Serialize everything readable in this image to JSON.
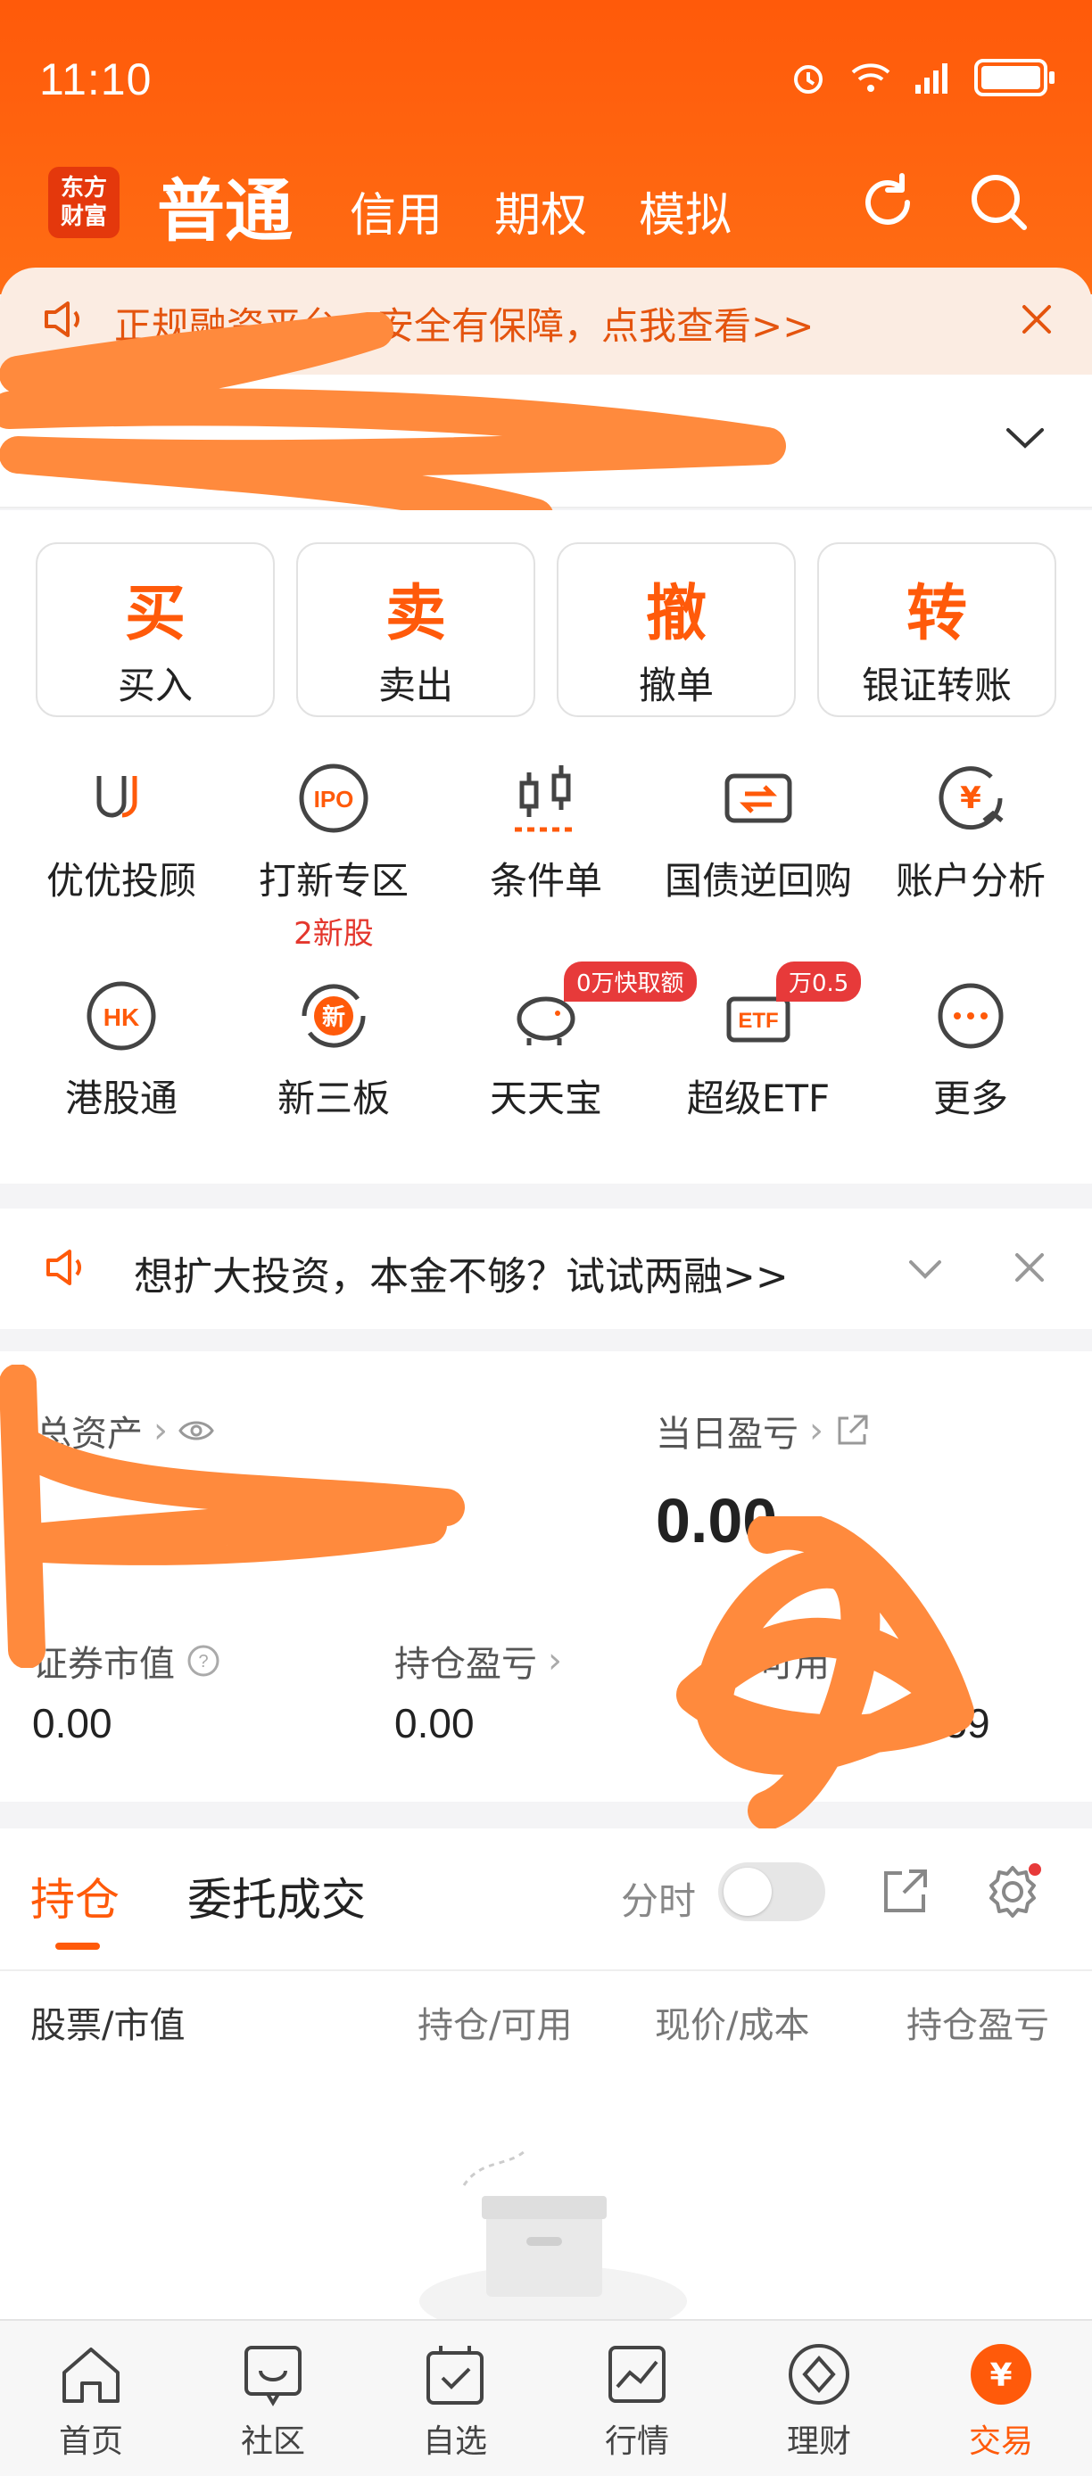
{
  "status_bar": {
    "time": "11:10"
  },
  "nav": {
    "logo": "东方\n财富",
    "tabs": [
      {
        "label": "普通",
        "active": true
      },
      {
        "label": "信用"
      },
      {
        "label": "期权"
      },
      {
        "label": "模拟"
      }
    ]
  },
  "notice": {
    "text": "正规融资平台，安全有保障，点我查看>>"
  },
  "actions": [
    {
      "big": "买",
      "small": "买入"
    },
    {
      "big": "卖",
      "small": "卖出"
    },
    {
      "big": "撤",
      "small": "撤单"
    },
    {
      "big": "转",
      "small": "银证转账"
    }
  ],
  "grid": [
    {
      "label": "优优投顾",
      "icon": "youyou-icon"
    },
    {
      "label": "打新专区",
      "icon": "ipo-icon",
      "sub": "2新股"
    },
    {
      "label": "条件单",
      "icon": "candlestick-icon"
    },
    {
      "label": "国债逆回购",
      "icon": "repo-icon"
    },
    {
      "label": "账户分析",
      "icon": "yen-chart-icon"
    },
    {
      "label": "港股通",
      "icon": "hk-icon"
    },
    {
      "label": "新三板",
      "icon": "new-board-icon"
    },
    {
      "label": "天天宝",
      "icon": "piggy-icon",
      "badge": "0万快取额"
    },
    {
      "label": "超级ETF",
      "icon": "etf-icon",
      "badge": "万0.5"
    },
    {
      "label": "更多",
      "icon": "more-icon"
    }
  ],
  "promo": {
    "text": "想扩大投资，本金不够？试试两融>>"
  },
  "assets": {
    "total_label": "总资产",
    "daily_pnl_label": "当日盈亏",
    "daily_pnl_value": "0.00",
    "market_value_label": "证券市值",
    "market_value": "0.00",
    "holding_pnl_label": "持仓盈亏",
    "holding_pnl": "0.00",
    "available_label": "可用",
    "available_value": "0.59"
  },
  "holdings": {
    "tab_positions": "持仓",
    "tab_orders": "委托成交",
    "timeshare_label": "分时",
    "columns": [
      "股票/市值",
      "持仓/可用",
      "现价/成本",
      "持仓盈亏"
    ]
  },
  "tabbar": [
    {
      "label": "首页",
      "icon": "home-icon"
    },
    {
      "label": "社区",
      "icon": "community-icon"
    },
    {
      "label": "自选",
      "icon": "watchlist-icon"
    },
    {
      "label": "行情",
      "icon": "market-icon"
    },
    {
      "label": "理财",
      "icon": "wealth-icon"
    },
    {
      "label": "交易",
      "icon": "trade-icon",
      "active": true
    }
  ],
  "colors": {
    "brand": "#ff5a0a",
    "badge_red": "#e73a3a",
    "scribble": "#ff8a3d"
  }
}
